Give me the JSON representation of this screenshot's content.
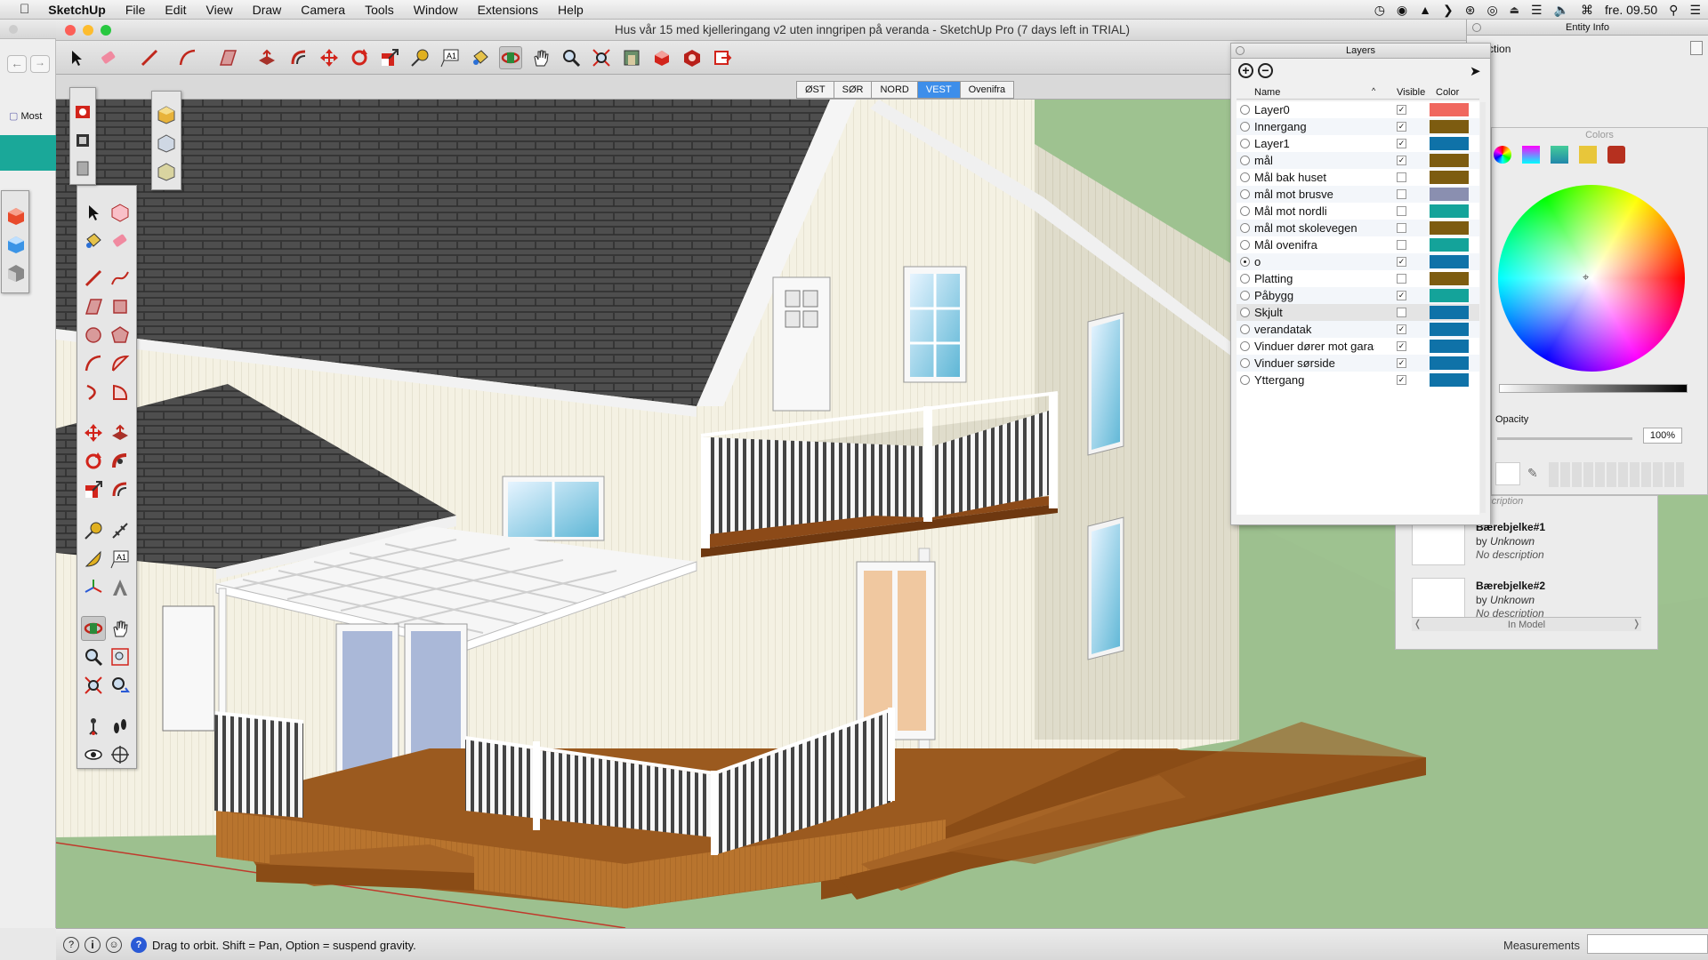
{
  "menubar": {
    "app_name": "SketchUp",
    "items": [
      "File",
      "Edit",
      "View",
      "Draw",
      "Camera",
      "Tools",
      "Window",
      "Extensions",
      "Help"
    ],
    "clock": "fre. 09.50"
  },
  "window": {
    "title": "Hus vår 15 med kjelleringang v2 uten inngripen på veranda - SketchUp Pro (7 days left in TRIAL)"
  },
  "scenes": {
    "tabs": [
      "ØST",
      "SØR",
      "NORD",
      "VEST",
      "Ovenifra"
    ],
    "active": "VEST"
  },
  "status": {
    "hint": "Drag to orbit. Shift = Pan, Option = suspend gravity.",
    "measurements_label": "Measurements",
    "measurements_value": ""
  },
  "layers": {
    "title": "Layers",
    "col_name": "Name",
    "col_visible": "Visible",
    "col_color": "Color",
    "rows": [
      {
        "name": "Layer0",
        "visible": true,
        "color": "#f0675e",
        "active": false
      },
      {
        "name": "Innergang",
        "visible": true,
        "color": "#7d5c10",
        "active": false
      },
      {
        "name": "Layer1",
        "visible": true,
        "color": "#0f72a8",
        "active": false
      },
      {
        "name": "mål",
        "visible": true,
        "color": "#7d5c10",
        "active": false
      },
      {
        "name": "Mål bak huset",
        "visible": false,
        "color": "#7d5c10",
        "active": false
      },
      {
        "name": "mål mot brusve",
        "visible": false,
        "color": "#8a8fb0",
        "active": false
      },
      {
        "name": "Mål mot nordli",
        "visible": false,
        "color": "#14a39a",
        "active": false
      },
      {
        "name": "mål mot skolevegen",
        "visible": false,
        "color": "#7d5c10",
        "active": false
      },
      {
        "name": "Mål ovenifra",
        "visible": false,
        "color": "#14a39a",
        "active": false
      },
      {
        "name": "o",
        "visible": true,
        "color": "#0f72a8",
        "active": true
      },
      {
        "name": "Platting",
        "visible": false,
        "color": "#7d5c10",
        "active": false
      },
      {
        "name": "Påbygg",
        "visible": true,
        "color": "#14a39a",
        "active": false
      },
      {
        "name": "Skjult",
        "visible": false,
        "color": "#0f72a8",
        "active": false
      },
      {
        "name": "verandatak",
        "visible": true,
        "color": "#0f72a8",
        "active": false
      },
      {
        "name": "Vinduer dører mot garasje",
        "visible": true,
        "color": "#0f72a8",
        "active": false
      },
      {
        "name": "Vinduer sørside",
        "visible": true,
        "color": "#0f72a8",
        "active": false
      },
      {
        "name": "Yttergang",
        "visible": true,
        "color": "#0f72a8",
        "active": false
      }
    ]
  },
  "entity_info": {
    "title": "Entity Info",
    "selection": "election"
  },
  "colors_panel": {
    "title": "Colors",
    "opacity_label": "Opacity",
    "opacity_value": "100%"
  },
  "components": {
    "cut_desc": "description",
    "items": [
      {
        "name": "Bærebjelke#1",
        "by": "by",
        "author": "Unknown",
        "desc": "No description"
      },
      {
        "name": "Bærebjelke#2",
        "by": "by",
        "author": "Unknown",
        "desc": "No description"
      }
    ],
    "footer": "In Model"
  },
  "browser": {
    "most_visited": "Most"
  }
}
